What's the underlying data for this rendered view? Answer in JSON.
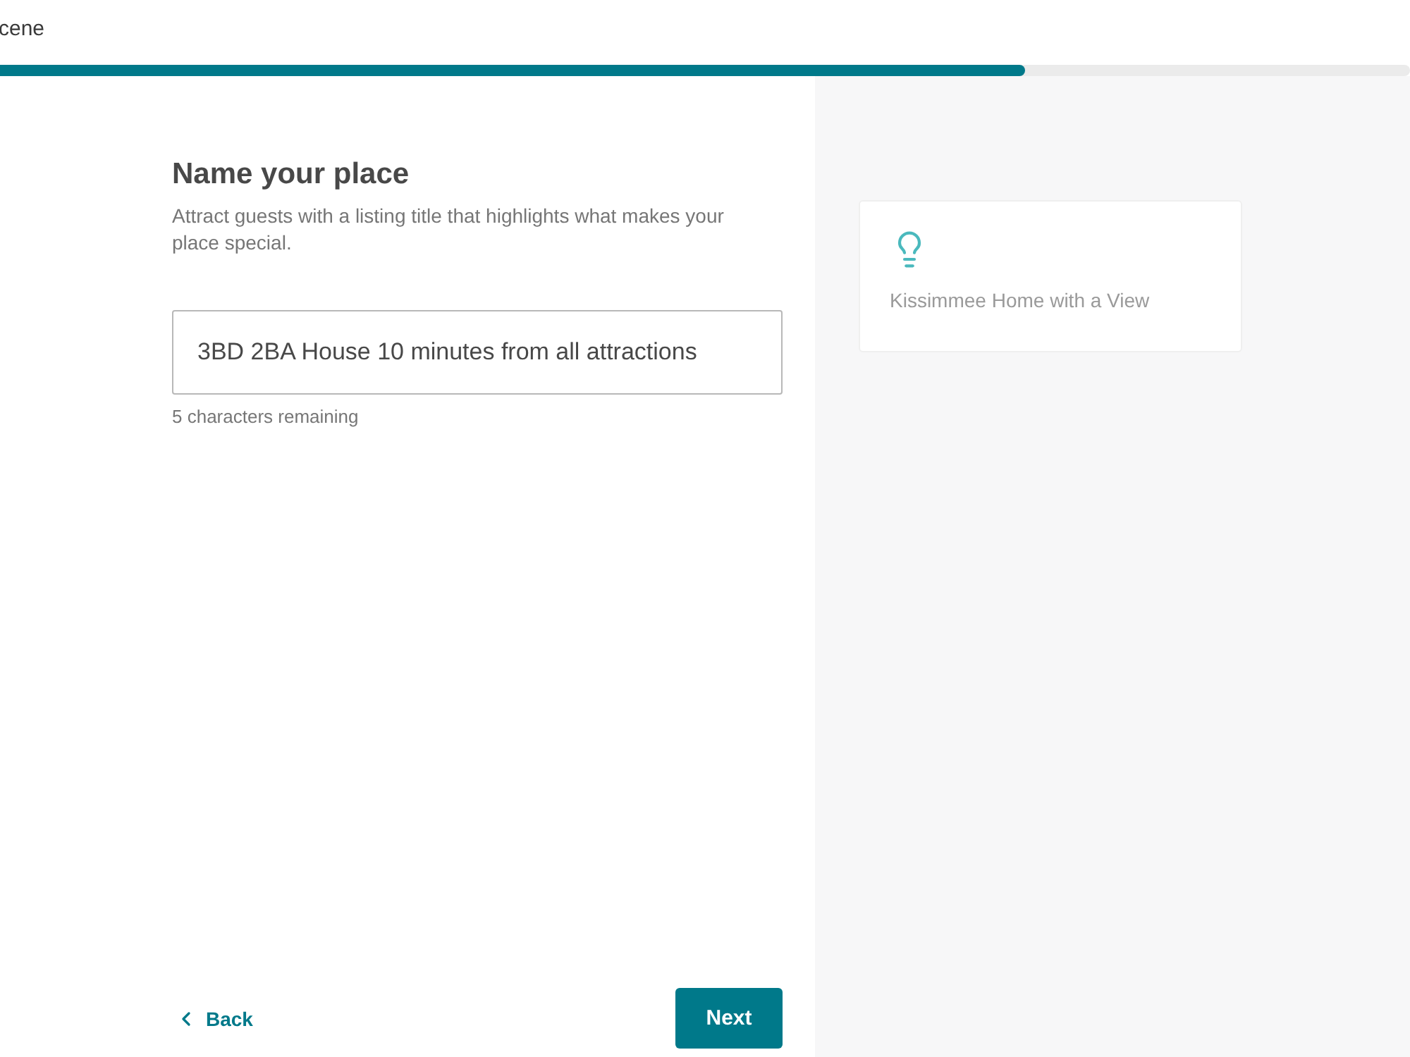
{
  "header": {
    "title": "cene"
  },
  "progress": {
    "level": 0.727
  },
  "form": {
    "heading": "Name your place",
    "description": "Attract guests with a listing title that highlights what makes your place special.",
    "title_field": {
      "value": "3BD 2BA House 10 minutes from all attractions"
    },
    "helper": "5 characters remaining"
  },
  "preview": {
    "title": "Kissimmee Home with a View"
  },
  "footer": {
    "back": "Back",
    "next": "Next"
  }
}
